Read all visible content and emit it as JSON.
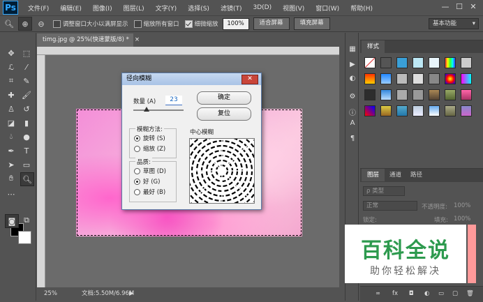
{
  "app": {
    "logo": "Ps",
    "menus": [
      "文件(F)",
      "编辑(E)",
      "图像(I)",
      "图层(L)",
      "文字(Y)",
      "选择(S)",
      "滤镜(T)",
      "3D(D)",
      "视图(V)",
      "窗口(W)",
      "帮助(H)"
    ],
    "window_controls": {
      "minimize": "—",
      "maximize": "☐",
      "close": "✕"
    }
  },
  "options_bar": {
    "resize_windows": "调整窗口大小以满屏显示",
    "zoom_all_windows": "缩放所有窗口",
    "scrubby_zoom": "细微缩放",
    "zoom_value": "100%",
    "fit_screen": "适合屏幕",
    "fill_screen": "填充屏幕",
    "workspace": "基本功能"
  },
  "document": {
    "tab_title": "timg.jpg @ 25%(快速蒙版/8) *",
    "tab_close": "×",
    "zoom": "25%",
    "doc_size": "文档:5.50M/6.96M",
    "status_arrow": "▶"
  },
  "dialog": {
    "title": "径向模糊",
    "close": "✕",
    "amount_label": "数量 (A)",
    "amount_value": "23",
    "ok": "确定",
    "reset": "复位",
    "blur_method": {
      "legend": "模糊方法:",
      "options": [
        "旋转 (S)",
        "缩放 (Z)"
      ],
      "selected": 0
    },
    "quality": {
      "legend": "品质:",
      "options": [
        "草图 (D)",
        "好 (G)",
        "最好 (B)"
      ],
      "selected": 1
    },
    "center_label": "中心模糊"
  },
  "panels": {
    "styles_tab": "样式",
    "layers_tabs": [
      "图层",
      "通道",
      "路径"
    ],
    "kind_filter": "ρ 类型",
    "blend_mode": "正常",
    "opacity_label": "不透明度:",
    "opacity_value": "100%",
    "lock_label": "锁定:",
    "fill_label": "填充:",
    "fill_value": "100%",
    "footer_icons": [
      "∞",
      "fx",
      "◘",
      "◐",
      "▭",
      "▢",
      "🗑"
    ]
  },
  "watermark": {
    "title": "百科全说",
    "subtitle": "助你轻松解决"
  },
  "colors": {
    "ui_bg": "#535353",
    "accent": "#31a8ff",
    "watermark_green": "#2d9a4e",
    "foreground": "#000000",
    "background": "#ffffff"
  }
}
